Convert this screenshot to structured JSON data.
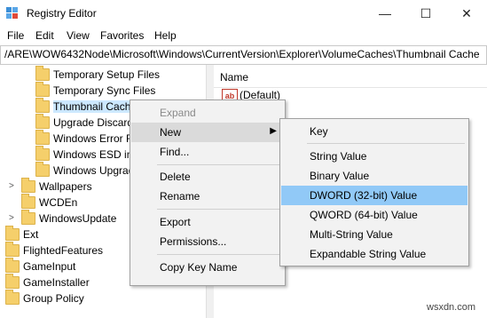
{
  "window": {
    "title": "Registry Editor",
    "minimize": "—",
    "maximize": "☐",
    "close": "✕"
  },
  "menubar": [
    "File",
    "Edit",
    "View",
    "Favorites",
    "Help"
  ],
  "address": "/ARE\\WOW6432Node\\Microsoft\\Windows\\CurrentVersion\\Explorer\\VolumeCaches\\Thumbnail Cache",
  "tree": [
    {
      "label": "Temporary Setup Files",
      "indent": 2
    },
    {
      "label": "Temporary Sync Files",
      "indent": 2
    },
    {
      "label": "Thumbnail Cache",
      "indent": 2,
      "selected": true
    },
    {
      "label": "Upgrade Discard",
      "indent": 2
    },
    {
      "label": "Windows Error R",
      "indent": 2
    },
    {
      "label": "Windows ESD ins",
      "indent": 2
    },
    {
      "label": "Windows Upgrad",
      "indent": 2
    },
    {
      "label": "Wallpapers",
      "indent": 1,
      "expandable": true
    },
    {
      "label": "WCDEn",
      "indent": 1
    },
    {
      "label": "WindowsUpdate",
      "indent": 1,
      "expandable": true
    },
    {
      "label": "Ext",
      "indent": 0
    },
    {
      "label": "FlightedFeatures",
      "indent": 0
    },
    {
      "label": "GameInput",
      "indent": 0
    },
    {
      "label": "GameInstaller",
      "indent": 0
    },
    {
      "label": "Group Policy",
      "indent": 0
    }
  ],
  "values_pane": {
    "column_name": "Name",
    "default_icon": "ab",
    "default_value": "(Default)"
  },
  "context_menu": {
    "expand": "Expand",
    "new": "New",
    "find": "Find...",
    "delete": "Delete",
    "rename": "Rename",
    "export": "Export",
    "permissions": "Permissions...",
    "copy_key_name": "Copy Key Name"
  },
  "submenu": {
    "key": "Key",
    "string_value": "String Value",
    "binary_value": "Binary Value",
    "dword_value": "DWORD (32-bit) Value",
    "qword_value": "QWORD (64-bit) Value",
    "multi_string_value": "Multi-String Value",
    "expandable_string_value": "Expandable String Value"
  },
  "watermark": "wsxdn.com"
}
